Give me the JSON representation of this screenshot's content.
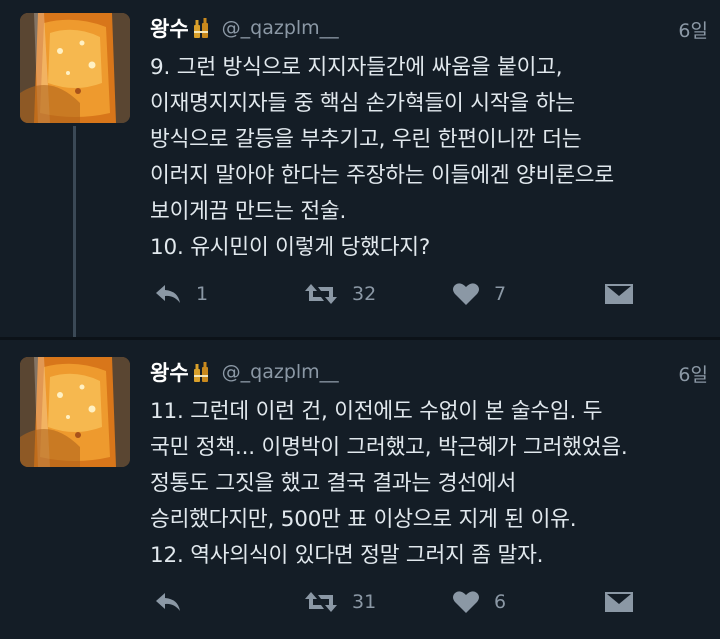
{
  "tweets": [
    {
      "display_name": "왕수",
      "name_icon": "bottles-icon",
      "handle": "@_qazplm__",
      "time": "6일",
      "lines": [
        "9. 그런 방식으로 지지자들간에 싸움을 붙이고,",
        "이재명지지자들 중 핵심 손가혁들이 시작을 하는",
        "방식으로 갈등을 부추기고, 우린 한편이니깐 더는",
        "이러지 말아야 한다는 주장하는 이들에겐 양비론으로",
        "보이게끔 만드는 전술.",
        "10. 유시민이 이렇게 당했다지?"
      ],
      "reply_count": "1",
      "retweet_count": "32",
      "like_count": "7"
    },
    {
      "display_name": "왕수",
      "name_icon": "bottles-icon",
      "handle": "@_qazplm__",
      "time": "6일",
      "lines": [
        "11. 그런데 이런 건, 이전에도 수없이 본 술수임. 두",
        "국민 정책... 이명박이 그러했고, 박근혜가 그러했었음.",
        "정통도 그짓을 했고 결국 결과는 경선에서",
        "승리했다지만, 500만 표 이상으로 지게 된 이유.",
        "12. 역사의식이 있다면 정말 그러지 좀 말자."
      ],
      "reply_count": "",
      "retweet_count": "31",
      "like_count": "6"
    }
  ],
  "icons": {
    "reply": "reply-icon",
    "retweet": "retweet-icon",
    "like": "heart-icon",
    "dm": "direct-message-icon"
  },
  "colors": {
    "background": "#141d26",
    "text": "#e1e8ed",
    "secondary": "#8b98a5",
    "accent_bottle": "#e08a1c"
  }
}
